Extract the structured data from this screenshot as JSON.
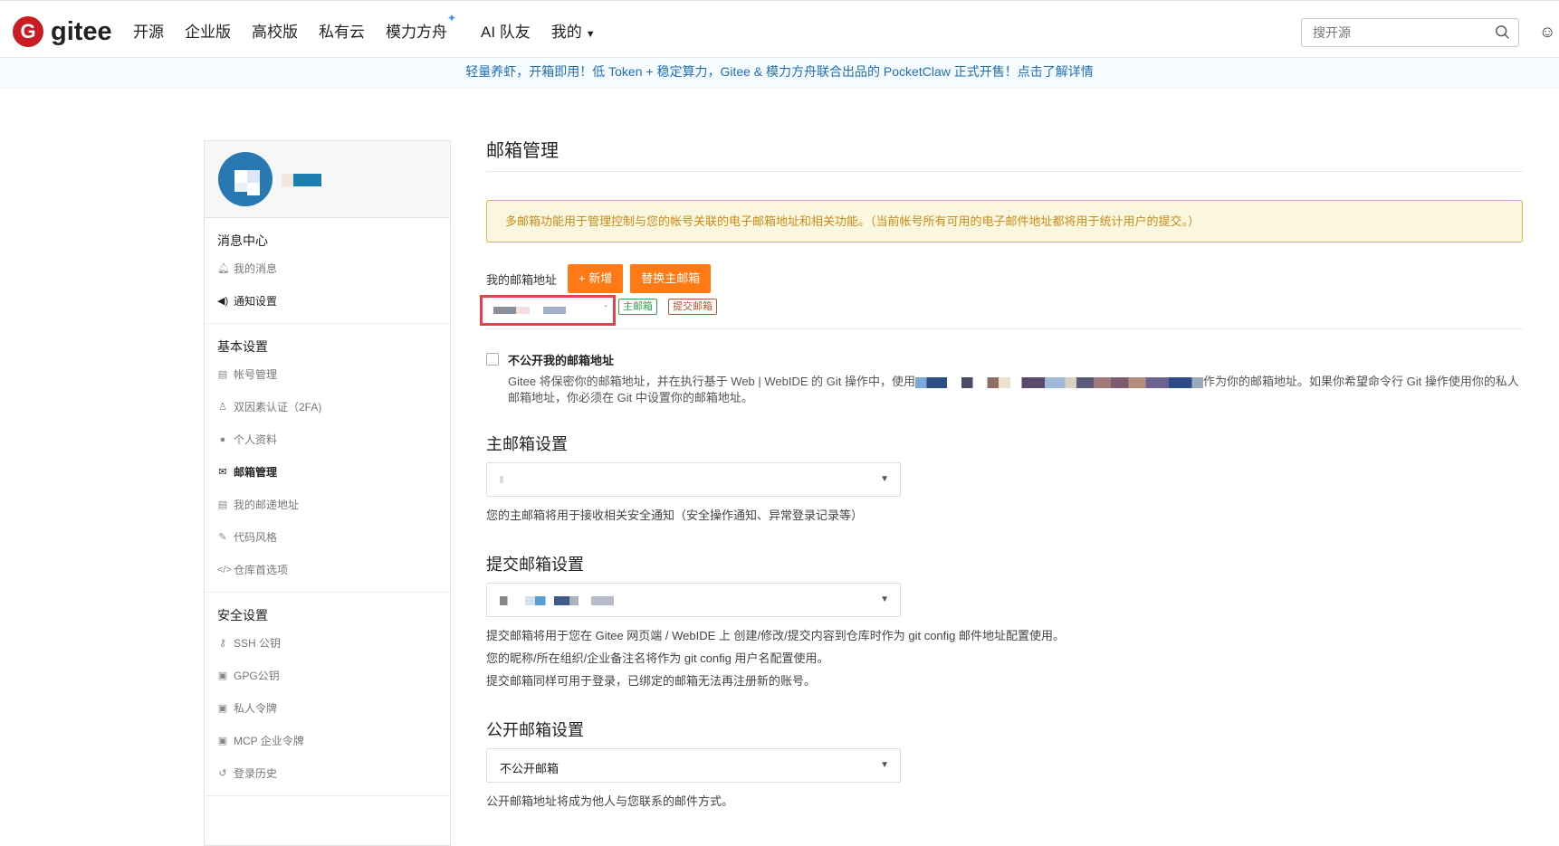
{
  "header": {
    "logo_mark": "G",
    "logo_text": "gitee",
    "nav": [
      {
        "label": "开源"
      },
      {
        "label": "企业版"
      },
      {
        "label": "高校版"
      },
      {
        "label": "私有云"
      },
      {
        "label": "模力方舟"
      },
      {
        "label": "AI 队友"
      },
      {
        "label": "我的"
      }
    ],
    "search_placeholder": "搜开源"
  },
  "banner": "轻量养虾，开箱即用！低 Token + 稳定算力，Gitee & 模力方舟联合出品的 PocketClaw 正式开售！点击了解详情",
  "sidebar": {
    "groups": [
      {
        "title": "消息中心",
        "items": [
          {
            "label": "我的消息"
          },
          {
            "label": "通知设置"
          }
        ]
      },
      {
        "title": "基本设置",
        "items": [
          {
            "label": "帐号管理"
          },
          {
            "label": "双因素认证（2FA)"
          },
          {
            "label": "个人资料"
          },
          {
            "label": "邮箱管理"
          },
          {
            "label": "我的邮递地址"
          },
          {
            "label": "代码风格"
          },
          {
            "label": "仓库首选项"
          }
        ]
      },
      {
        "title": "安全设置",
        "items": [
          {
            "label": "SSH 公钥"
          },
          {
            "label": "GPG公钥"
          },
          {
            "label": "私人令牌"
          },
          {
            "label": "MCP 企业令牌"
          },
          {
            "label": "登录历史"
          }
        ]
      }
    ],
    "active_item": "邮箱管理"
  },
  "main": {
    "title": "邮箱管理",
    "notice": "多邮箱功能用于管理控制与您的帐号关联的电子邮箱地址和相关功能。（当前帐号所有可用的电子邮件地址都将用于统计用户的提交。）",
    "my_emails_label": "我的邮箱地址",
    "add_button": "+ 新增",
    "replace_button": "替换主邮箱",
    "tag_primary": "主邮箱",
    "tag_commit": "提交邮箱",
    "hide_title": "不公开我的邮箱地址",
    "hide_desc_before": "Gitee 将保密你的邮箱地址，并在执行基于 Web | WebIDE 的 Git 操作中，使用",
    "hide_desc_after": "作为你的邮箱地址。如果你希望命令行 Git 操作使用你的私人邮箱地址，你必须在 Git 中设置你的邮箱地址。",
    "primary_title": "主邮箱设置",
    "primary_help": "您的主邮箱将用于接收相关安全通知（安全操作通知、异常登录记录等）",
    "commit_title": "提交邮箱设置",
    "commit_help": [
      "提交邮箱将用于您在 Gitee 网页端 / WebIDE 上 创建/修改/提交内容到仓库时作为 git config 邮件地址配置使用。",
      "您的昵称/所在组织/企业备注名将作为 git config 用户名配置使用。",
      "提交邮箱同样可用于登录，已绑定的邮箱无法再注册新的账号。"
    ],
    "public_title": "公开邮箱设置",
    "public_value": "不公开邮箱",
    "public_help": "公开邮箱地址将成为他人与您联系的邮件方式。"
  },
  "colors": {
    "accent": "#ff7a14",
    "brand": "#c71d23",
    "highlight_box": "#e3434a"
  }
}
